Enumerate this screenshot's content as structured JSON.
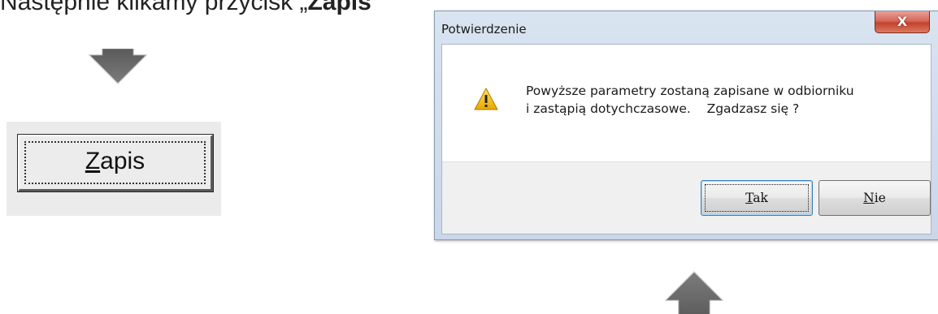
{
  "instruction": {
    "prefix": "Następnie klikamy przycisk ",
    "quote_open": "„",
    "bold": "Zapis",
    "quote_close": "”"
  },
  "zapis_button": {
    "mnemonic": "Z",
    "rest": "apis"
  },
  "dialog": {
    "title": "Potwierdzenie",
    "close_glyph": "X",
    "message_line1": "Powyższe parametry zostaną zapisane w odbiorniku",
    "message_line2": "i zastąpią dotychczasowe.    Zgadzasz się ?",
    "yes_mnemonic": "T",
    "yes_rest": "ak",
    "no_mnemonic": "N",
    "no_rest": "ie"
  },
  "icons": {
    "warning": "warning-icon",
    "arrow_down": "arrow-down-icon",
    "arrow_up": "arrow-up-icon",
    "close": "close-icon"
  },
  "colors": {
    "arrow": "#6a6a6a",
    "close_button": "#c4422f",
    "warning": "#f2c40f"
  }
}
